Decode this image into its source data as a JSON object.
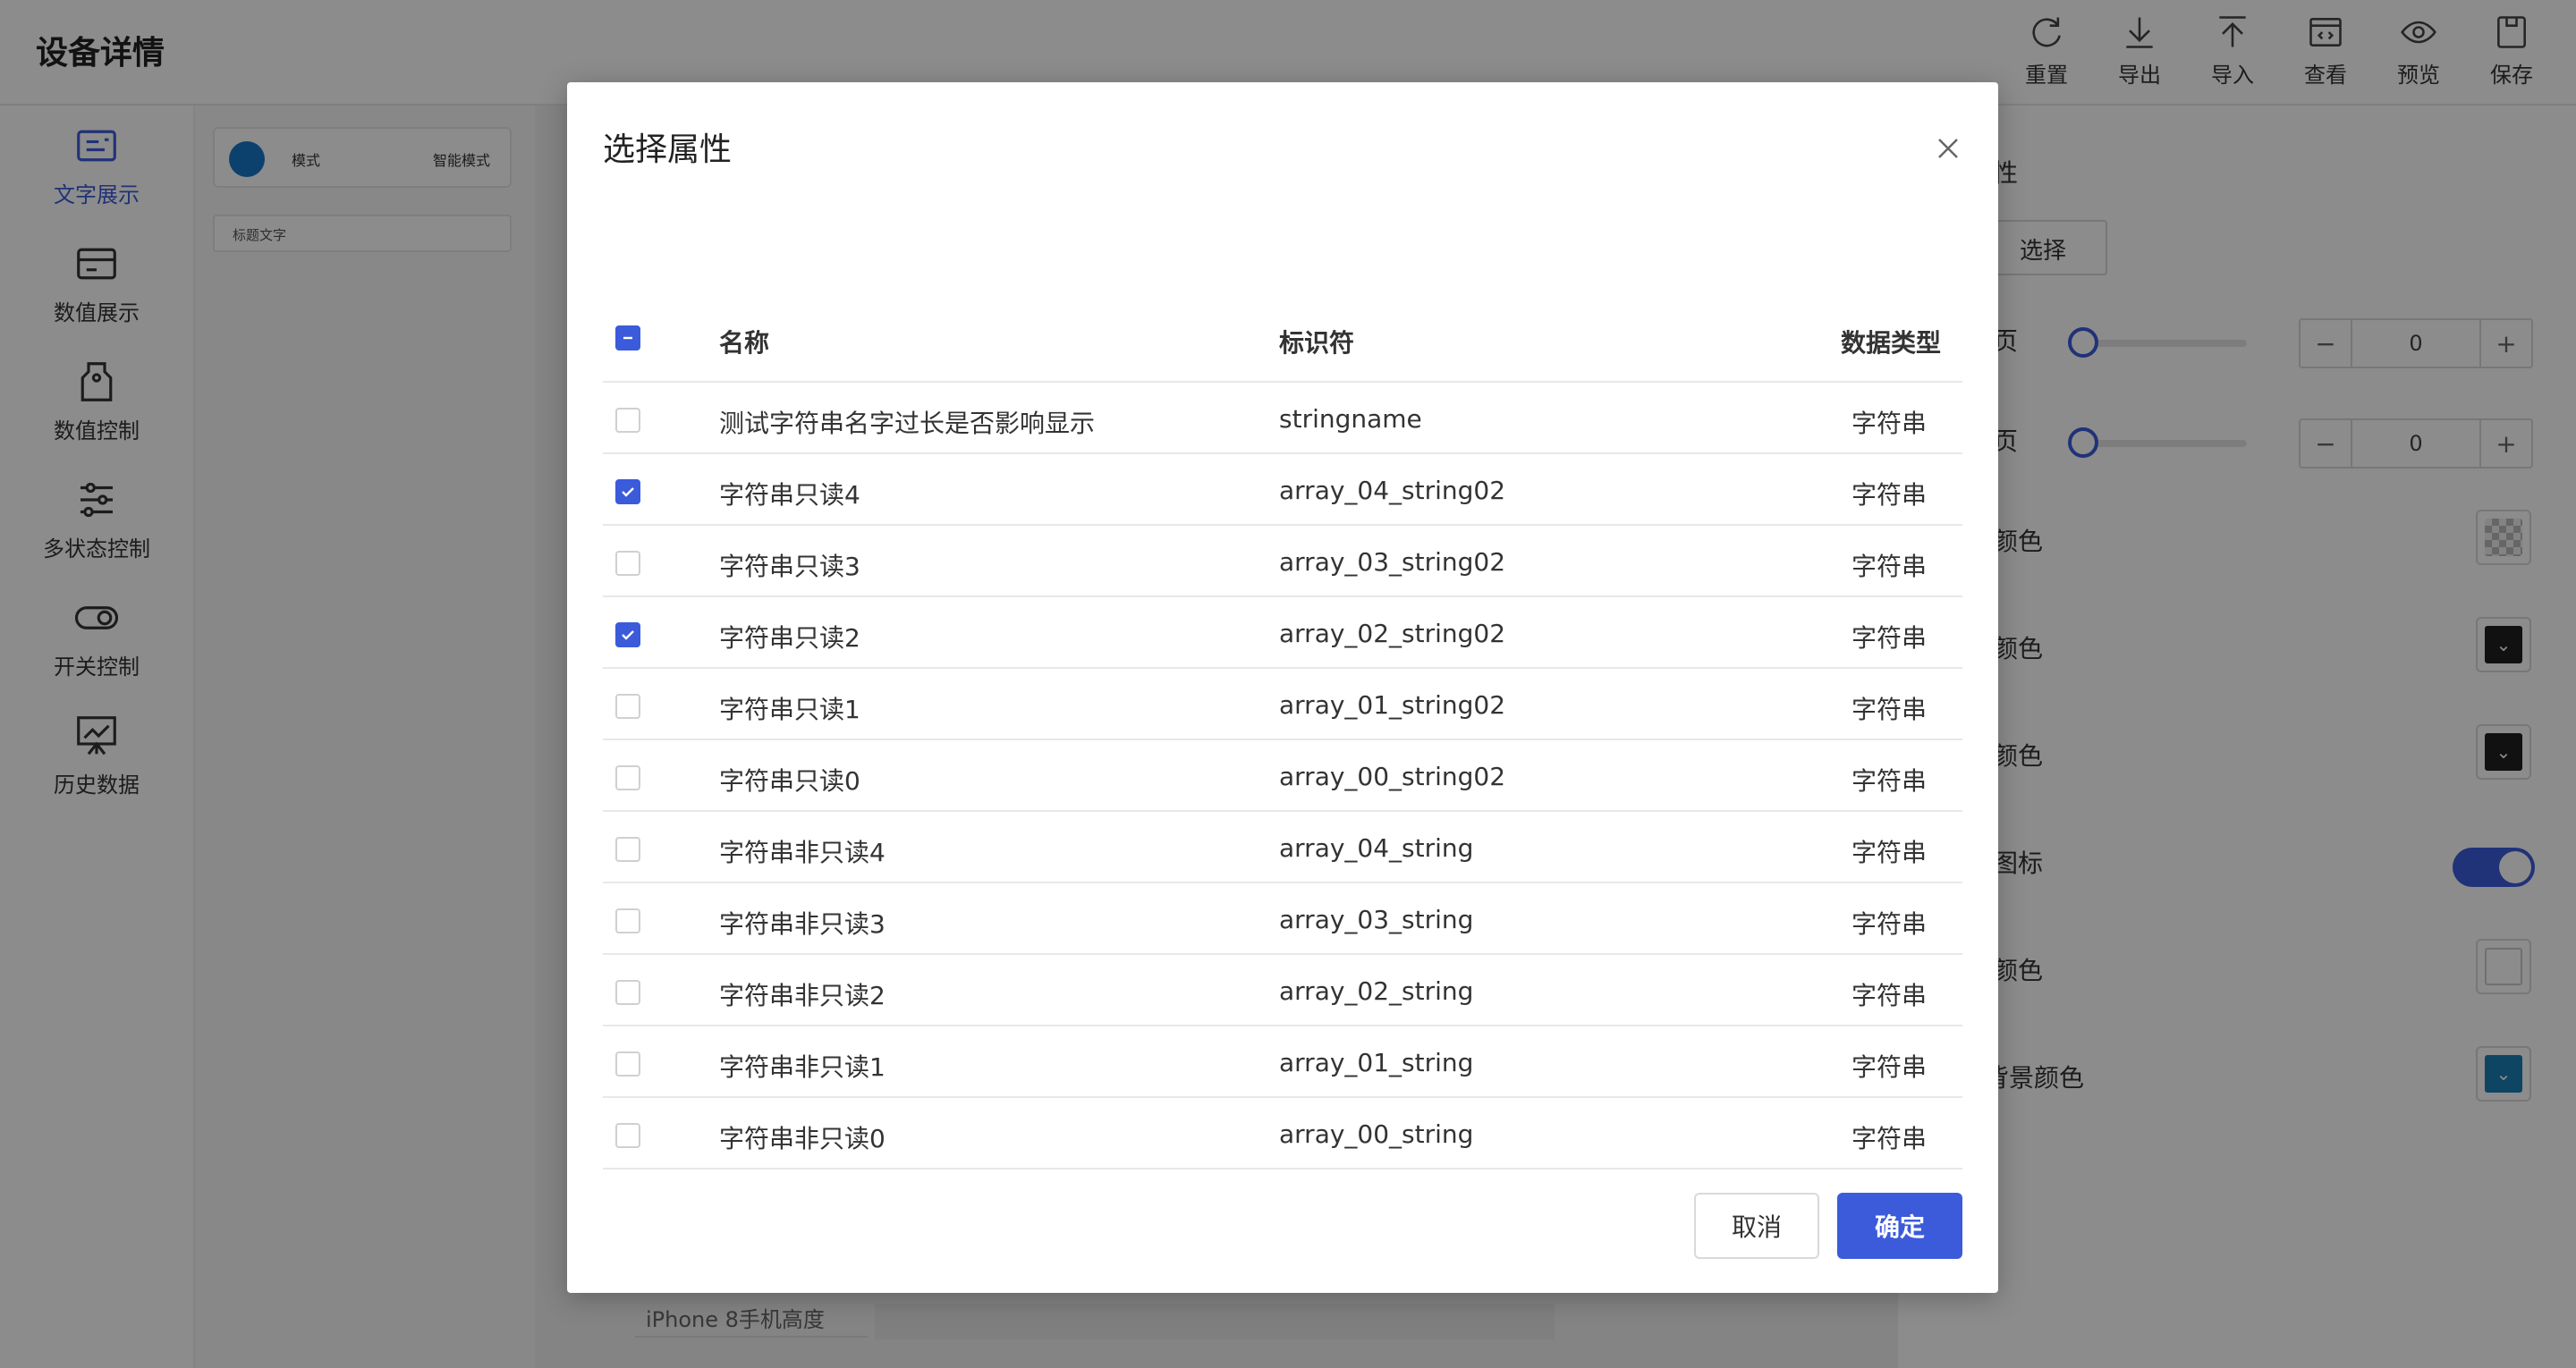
{
  "header": {
    "title": "设备详情",
    "toolbar": [
      {
        "label": "重置",
        "icon": "refresh-icon"
      },
      {
        "label": "导出",
        "icon": "download-icon"
      },
      {
        "label": "导入",
        "icon": "upload-icon"
      },
      {
        "label": "查看",
        "icon": "code-icon"
      },
      {
        "label": "预览",
        "icon": "eye-icon"
      },
      {
        "label": "保存",
        "icon": "save-icon"
      }
    ]
  },
  "sidebar": {
    "items": [
      {
        "label": "文字展示",
        "icon": "text-display-icon",
        "active": true
      },
      {
        "label": "数值展示",
        "icon": "card-icon"
      },
      {
        "label": "数值控制",
        "icon": "tag-icon"
      },
      {
        "label": "多状态控制",
        "icon": "sliders-icon"
      },
      {
        "label": "开关控制",
        "icon": "toggle-icon"
      },
      {
        "label": "历史数据",
        "icon": "chart-icon"
      }
    ]
  },
  "components": {
    "mode_label": "模式",
    "mode_value": "智能模式",
    "text_label": "标题文字"
  },
  "canvas": {
    "phone_label": "iPhone 8手机高度"
  },
  "properties": {
    "section_fragment": "性",
    "select_fragment": "选择",
    "slider1_fragment": "页",
    "slider1_value": "0",
    "slider2_fragment": "页",
    "slider2_value": "0",
    "color1_fragment": "颜色",
    "color2_fragment": "颜色",
    "color3_fragment": "颜色",
    "icon_fragment": "图标",
    "color4_fragment": "颜色",
    "bg_fragment": "背景颜色",
    "colors": {
      "dark": "#1f1f1f",
      "accent": "#1a7fb5",
      "toggle": "#3b5bdb"
    }
  },
  "modal": {
    "title": "选择属性",
    "columns": {
      "name": "名称",
      "id": "标识符",
      "type": "数据类型"
    },
    "rows": [
      {
        "name": "测试字符串名字过长是否影响显示",
        "id": "stringname",
        "type": "字符串",
        "checked": false
      },
      {
        "name": "字符串只读4",
        "id": "array_04_string02",
        "type": "字符串",
        "checked": true
      },
      {
        "name": "字符串只读3",
        "id": "array_03_string02",
        "type": "字符串",
        "checked": false
      },
      {
        "name": "字符串只读2",
        "id": "array_02_string02",
        "type": "字符串",
        "checked": true
      },
      {
        "name": "字符串只读1",
        "id": "array_01_string02",
        "type": "字符串",
        "checked": false
      },
      {
        "name": "字符串只读0",
        "id": "array_00_string02",
        "type": "字符串",
        "checked": false
      },
      {
        "name": "字符串非只读4",
        "id": "array_04_string",
        "type": "字符串",
        "checked": false
      },
      {
        "name": "字符串非只读3",
        "id": "array_03_string",
        "type": "字符串",
        "checked": false
      },
      {
        "name": "字符串非只读2",
        "id": "array_02_string",
        "type": "字符串",
        "checked": false
      },
      {
        "name": "字符串非只读1",
        "id": "array_01_string",
        "type": "字符串",
        "checked": false
      },
      {
        "name": "字符串非只读0",
        "id": "array_00_string",
        "type": "字符串",
        "checked": false
      }
    ],
    "cancel_label": "取消",
    "ok_label": "确定",
    "accent_color": "#3b5bdb"
  }
}
